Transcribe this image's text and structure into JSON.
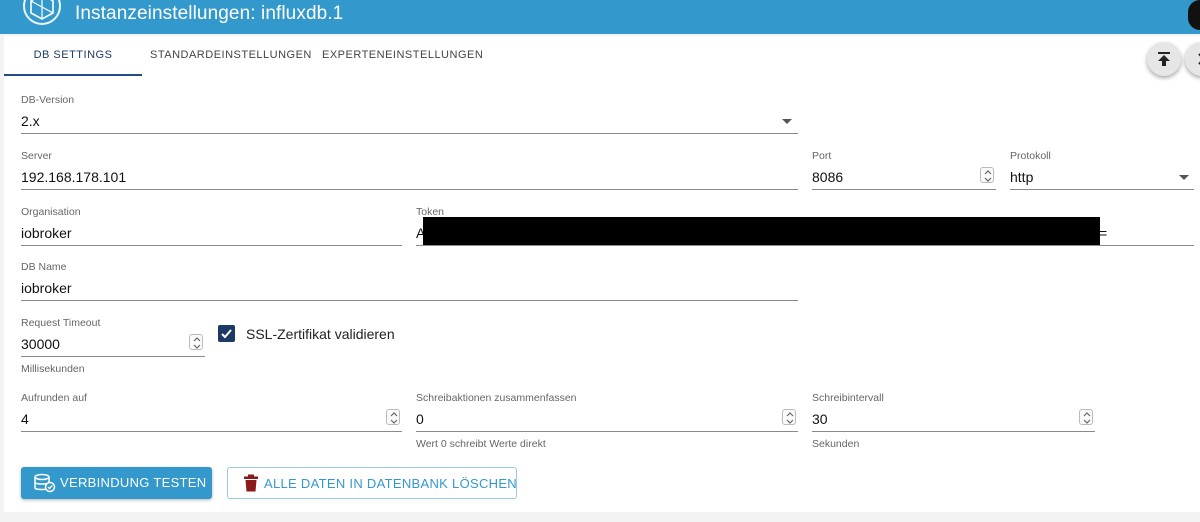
{
  "header": {
    "title": "Instanzeinstellungen: influxdb.1",
    "logo_icon": "iobroker-logo-icon"
  },
  "tabs": [
    {
      "label": "DB SETTINGS",
      "active": true
    },
    {
      "label": "STANDARDEINSTELLUNGEN",
      "active": false
    },
    {
      "label": "EXPERTENEINSTELLUNGEN",
      "active": false
    }
  ],
  "toolbar": {
    "scroll_top_icon": "scroll-to-top-icon",
    "expand_icon": "chevron-right-icon"
  },
  "form": {
    "db_version": {
      "label": "DB-Version",
      "value": "2.x"
    },
    "server": {
      "label": "Server",
      "value": "192.168.178.101"
    },
    "port": {
      "label": "Port",
      "value": "8086"
    },
    "protocol": {
      "label": "Protokoll",
      "value": "http"
    },
    "organisation": {
      "label": "Organisation",
      "value": "iobroker"
    },
    "token": {
      "label": "Token",
      "value_start": "A",
      "value_end": "="
    },
    "db_name": {
      "label": "DB Name",
      "value": "iobroker"
    },
    "request_timeout": {
      "label": "Request Timeout",
      "value": "30000",
      "helper": "Millisekunden"
    },
    "ssl": {
      "label": "SSL-Zertifikat validieren",
      "checked": true
    },
    "round": {
      "label": "Aufrunden auf",
      "value": "4"
    },
    "batch": {
      "label": "Schreibaktionen zusammenfassen",
      "value": "0",
      "helper": "Wert 0 schreibt Werte direkt"
    },
    "interval": {
      "label": "Schreibintervall",
      "value": "30",
      "helper": "Sekunden"
    }
  },
  "buttons": {
    "test": {
      "label": "VERBINDUNG TESTEN",
      "icon": "database-check-icon"
    },
    "delete": {
      "label": "ALLE DATEN IN DATENBANK LÖSCHEN",
      "icon": "trash-icon"
    }
  },
  "colors": {
    "header": "#3399cc",
    "primary": "#3399cc",
    "tab_active": "#1d4f86",
    "checkbox": "#1d3a66",
    "delete_icon": "#8b1a1a"
  }
}
